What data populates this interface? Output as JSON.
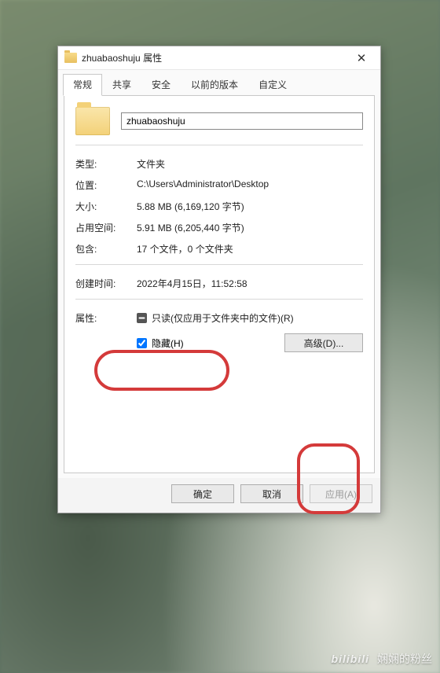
{
  "window": {
    "title": "zhuabaoshuju 属性",
    "close_icon": "✕"
  },
  "tabs": {
    "items": [
      "常规",
      "共享",
      "安全",
      "以前的版本",
      "自定义"
    ],
    "active_index": 0
  },
  "general": {
    "name_value": "zhuabaoshuju",
    "rows": {
      "type_label": "类型:",
      "type_value": "文件夹",
      "location_label": "位置:",
      "location_value": "C:\\Users\\Administrator\\Desktop",
      "size_label": "大小:",
      "size_value": "5.88 MB (6,169,120 字节)",
      "sizeondisk_label": "占用空间:",
      "sizeondisk_value": "5.91 MB (6,205,440 字节)",
      "contains_label": "包含:",
      "contains_value": "17 个文件，0 个文件夹",
      "created_label": "创建时间:",
      "created_value": "2022年4月15日，11:52:58",
      "attr_label": "属性:",
      "readonly_label": "只读(仅应用于文件夹中的文件)(R)",
      "hidden_label": "隐藏(H)",
      "advanced_button": "高级(D)..."
    }
  },
  "footer": {
    "ok": "确定",
    "cancel": "取消",
    "apply": "应用(A)"
  },
  "watermark": {
    "logo": "bilibili",
    "text": "娴娴的粉丝"
  }
}
